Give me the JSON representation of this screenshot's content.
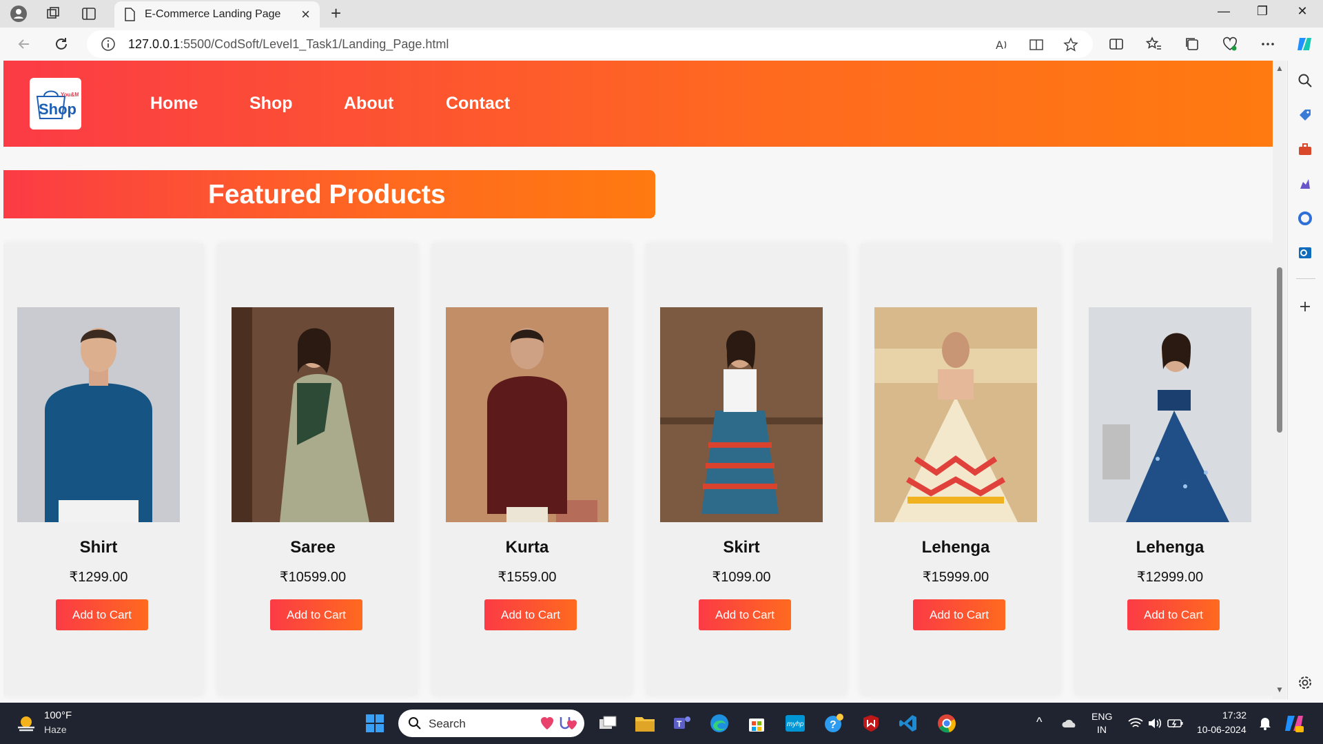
{
  "browser": {
    "tab_title": "E-Commerce Landing Page",
    "url_host": "127.0.0.1",
    "url_path": ":5500/CodSoft/Level1_Task1/Landing_Page.html"
  },
  "site": {
    "logo_small": "You&Me",
    "logo_text": "Shop",
    "nav": [
      "Home",
      "Shop",
      "About",
      "Contact"
    ],
    "featured_title": "Featured Products"
  },
  "products": [
    {
      "name": "Shirt",
      "price": "₹1299.00",
      "button": "Add to Cart"
    },
    {
      "name": "Saree",
      "price": "₹10599.00",
      "button": "Add to Cart"
    },
    {
      "name": "Kurta",
      "price": "₹1559.00",
      "button": "Add to Cart"
    },
    {
      "name": "Skirt",
      "price": "₹1099.00",
      "button": "Add to Cart"
    },
    {
      "name": "Lehenga",
      "price": "₹15999.00",
      "button": "Add to Cart"
    },
    {
      "name": "Lehenga",
      "price": "₹12999.00",
      "button": "Add to Cart"
    }
  ],
  "taskbar": {
    "temperature": "100°F",
    "weather": "Haze",
    "search_placeholder": "Search",
    "lang_1": "ENG",
    "lang_2": "IN",
    "time": "17:32",
    "date": "10-06-2024"
  },
  "colors": {
    "accent_start": "#fb3b45",
    "accent_end": "#ff7a10"
  }
}
